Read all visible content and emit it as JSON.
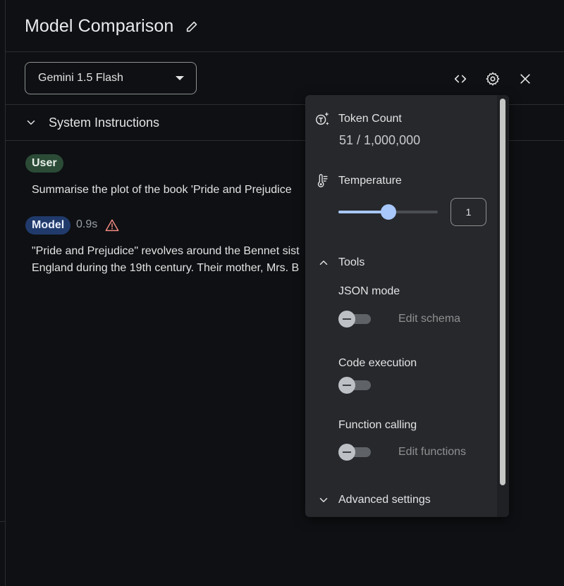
{
  "header": {
    "title": "Model Comparison",
    "edit_icon": "pencil-icon"
  },
  "toolbar": {
    "model_select_value": "Gemini 1.5 Flash",
    "icons": [
      "code-icon",
      "gear-icon",
      "close-icon"
    ]
  },
  "system_instructions": {
    "label": "System Instructions",
    "icon": "chevron-down-icon"
  },
  "chat": {
    "user_chip": "User",
    "user_message": "Summarise the plot of the book 'Pride and Prejudice",
    "model_chip": "Model",
    "model_time": "0.9s",
    "model_line_1": "\"Pride and Prejudice\" revolves around the Bennet sist",
    "model_line_2": "England during the 19th century. Their mother, Mrs. B"
  },
  "settings_panel": {
    "token_count_label": "Token Count",
    "token_count_value": "51 / 1,000,000",
    "temperature_label": "Temperature",
    "temperature_value": "1",
    "temperature_slider_fraction": 0.5,
    "tools_label": "Tools",
    "json_mode_label": "JSON mode",
    "json_mode_on": false,
    "edit_schema_label": "Edit schema",
    "code_execution_label": "Code execution",
    "code_execution_on": false,
    "function_calling_label": "Function calling",
    "function_calling_on": false,
    "edit_functions_label": "Edit functions",
    "advanced_settings_label": "Advanced settings"
  },
  "colors": {
    "background": "#0e1013",
    "panel": "#26282c",
    "accent": "#a8c7fa",
    "user_chip": "#2b4b36",
    "model_chip": "#203a6b",
    "warning": "#f28b82"
  }
}
